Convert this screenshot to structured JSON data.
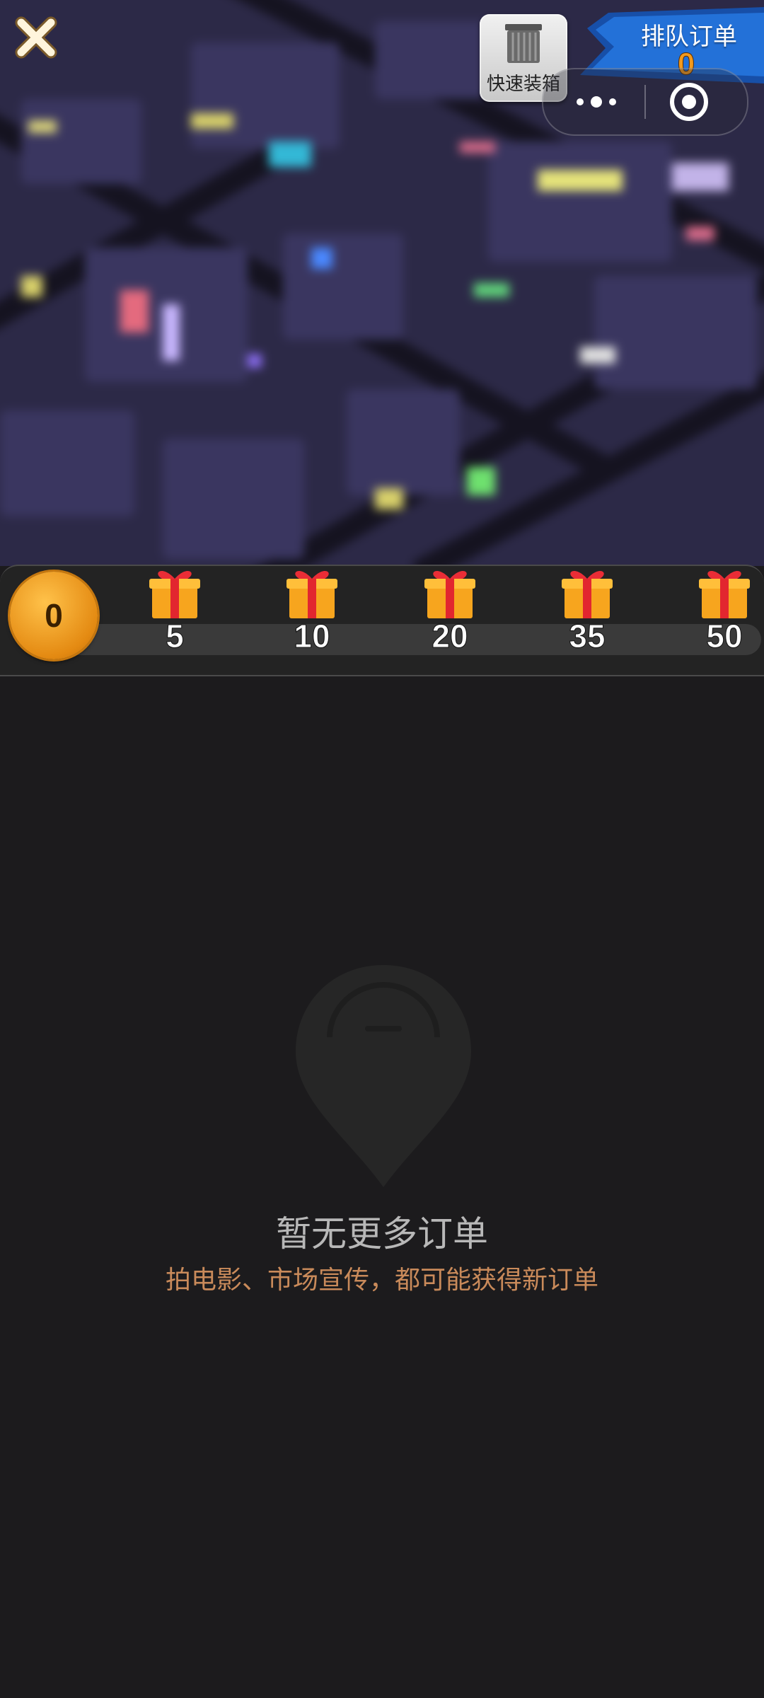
{
  "header": {
    "quick_pack_label": "快速装箱",
    "queue_title": "排队订单",
    "queue_count": "0"
  },
  "progress": {
    "current": "0",
    "milestones": [
      {
        "value": "5"
      },
      {
        "value": "10"
      },
      {
        "value": "20"
      },
      {
        "value": "35"
      },
      {
        "value": "50"
      }
    ]
  },
  "empty_state": {
    "title": "暂无更多订单",
    "subtitle": "拍电影、市场宣传，都可能获得新订单"
  },
  "icons": {
    "close": "close-icon",
    "quick_pack": "crate-icon",
    "more": "more-dots-icon",
    "target": "target-icon",
    "gift": "gift-icon",
    "pin": "map-pin-icon"
  },
  "colors": {
    "accent_orange": "#f39a1d",
    "flag_blue": "#1f63c8",
    "subtitle": "#c98a5a",
    "background": "#1c1b1d"
  }
}
